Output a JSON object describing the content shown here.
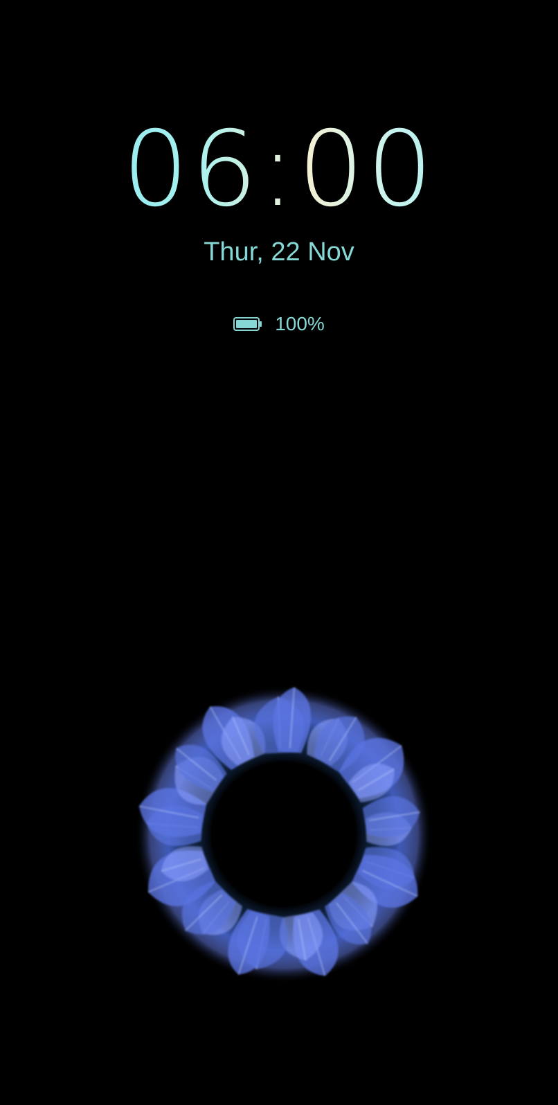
{
  "lockscreen": {
    "time": "06:00",
    "date": "Thur, 22 Nov",
    "battery": {
      "percent_label": "100%",
      "level": 1.0,
      "icon": "battery-full-icon"
    }
  },
  "colors": {
    "background": "#000000",
    "accent": "#86d8d6",
    "orb": "#5a78e6"
  },
  "decoration": {
    "icon": "particle-orb-wallpaper"
  }
}
